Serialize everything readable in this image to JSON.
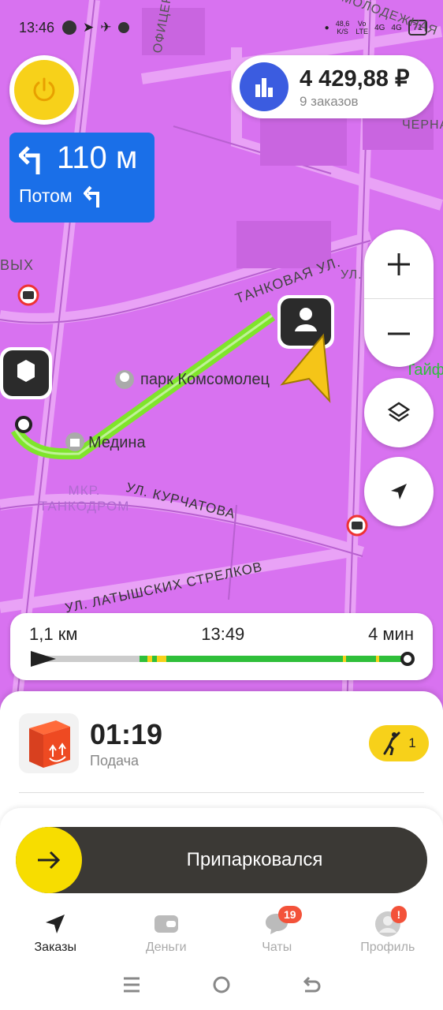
{
  "status_bar": {
    "time": "13:46",
    "net_speed": "48,6",
    "net_unit": "K/S",
    "volte_top": "Vo",
    "volte_bottom": "LTE",
    "sig1": "4G",
    "sig2": "4G",
    "battery": "71"
  },
  "earnings": {
    "amount": "4 429,88 ₽",
    "orders": "9 заказов"
  },
  "navigation": {
    "distance": "110 м",
    "then_label": "Потом"
  },
  "map": {
    "labels": [
      "ОФИЦЕРСК",
      "МОЛОДЕЖНАЯ",
      "ВЫХ",
      "ТАНКОВАЯ УЛ.",
      "УЛ.",
      "ЧЕРНАЯ",
      "парк Комсомолец",
      "Медина",
      "МКР. ТАНКОДРОМ",
      "УЛ. КУРЧАТОВА",
      "УЛ. ЛАТЫШСКИХ СТРЕЛКОВ",
      "Тайф"
    ]
  },
  "route": {
    "distance": "1,1 км",
    "eta": "13:49",
    "duration": "4 мин"
  },
  "order": {
    "time": "01:19",
    "subtitle": "Подача",
    "passengers": "1"
  },
  "action": {
    "label": "Припарковался"
  },
  "tabs": [
    {
      "label": "Заказы",
      "icon": "navigation-arrow-icon"
    },
    {
      "label": "Деньги",
      "icon": "wallet-icon"
    },
    {
      "label": "Чаты",
      "icon": "chat-icon",
      "badge": "19"
    },
    {
      "label": "Профиль",
      "icon": "avatar-icon",
      "badge": "!"
    }
  ],
  "colors": {
    "map_bg": "#d872f0",
    "accent_yellow": "#f7d11a",
    "nav_blue": "#1a6fe8",
    "route_green": "#2fbf3a",
    "action_dark": "#3b3935"
  }
}
